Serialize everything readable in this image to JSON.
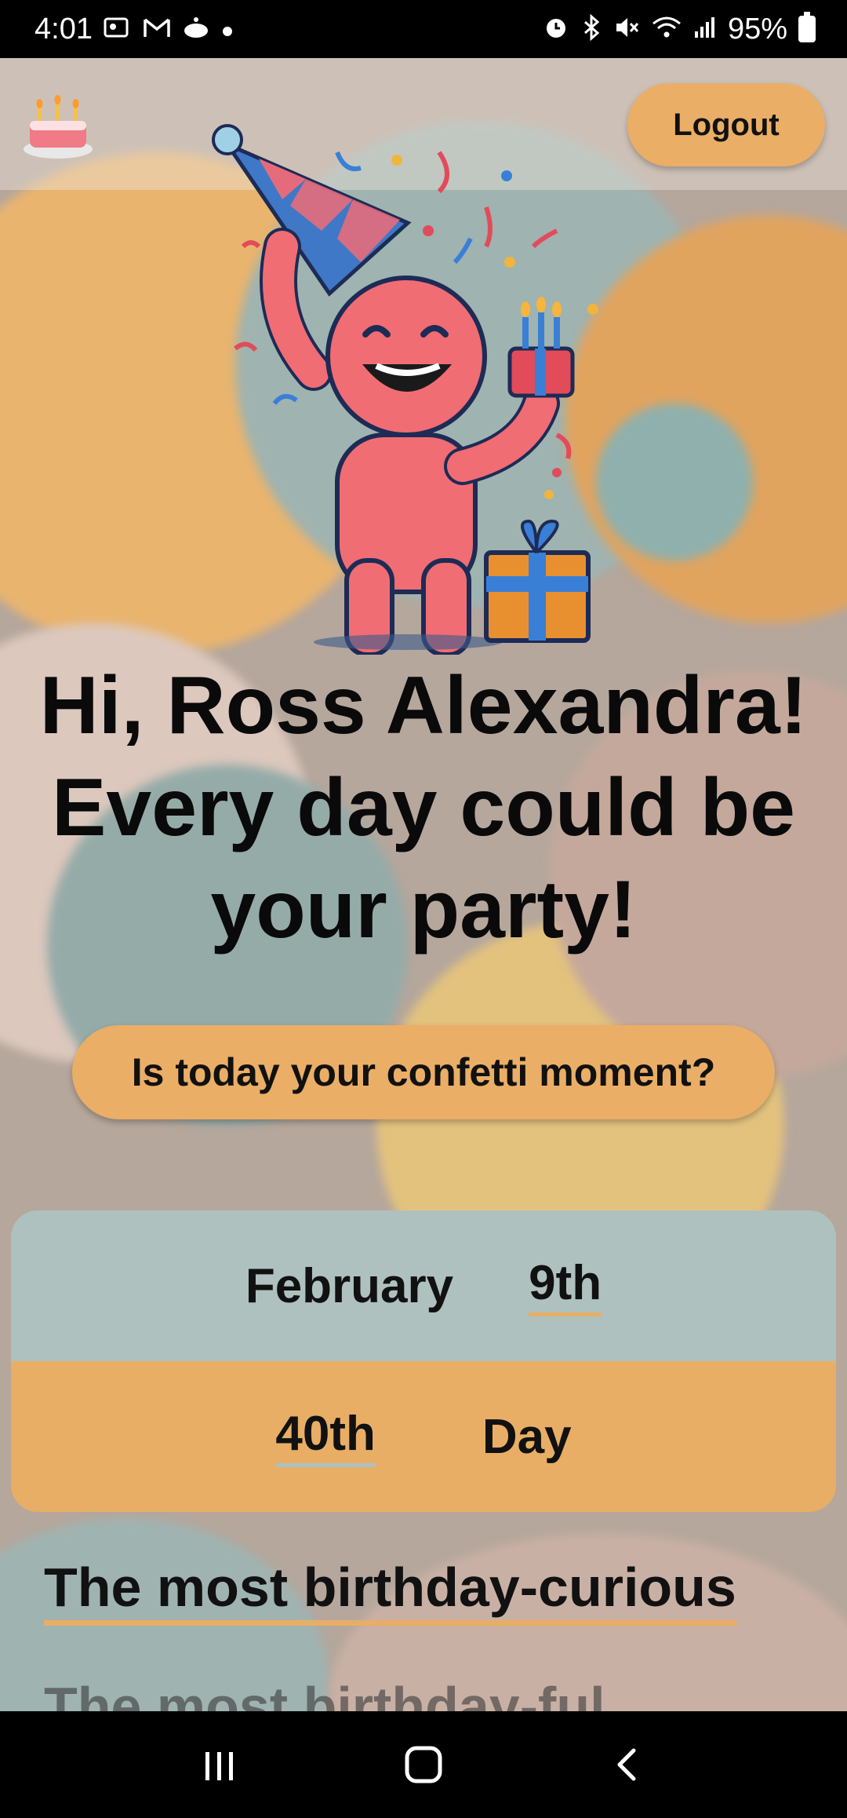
{
  "status_bar": {
    "time": "4:01",
    "battery": "95%",
    "left_icons": [
      "photo-icon",
      "gmail-icon",
      "reddit-icon",
      "dot-icon"
    ],
    "right_icons": [
      "alarm-icon",
      "bluetooth-icon",
      "mute-icon",
      "wifi-icon",
      "signal-icon",
      "battery-icon"
    ]
  },
  "header": {
    "logo_icon": "birthday-cake-icon",
    "logout_label": "Logout"
  },
  "hero": {
    "mascot": "party-mascot-illustration",
    "greeting_line1": "Hi, Ross Alexandra!",
    "greeting_line2": "Every day could be",
    "greeting_line3": "your party!",
    "cta_label": "Is today your confetti moment?"
  },
  "date_card": {
    "month": "February",
    "day": "9th",
    "ordinal": "40th",
    "unit": "Day"
  },
  "sections": {
    "heading1": "The most birthday-curious",
    "heading2": "The most birthday-ful"
  },
  "colors": {
    "accent_orange": "#eaae66",
    "card_teal": "#aec1bf",
    "text": "#111111"
  }
}
